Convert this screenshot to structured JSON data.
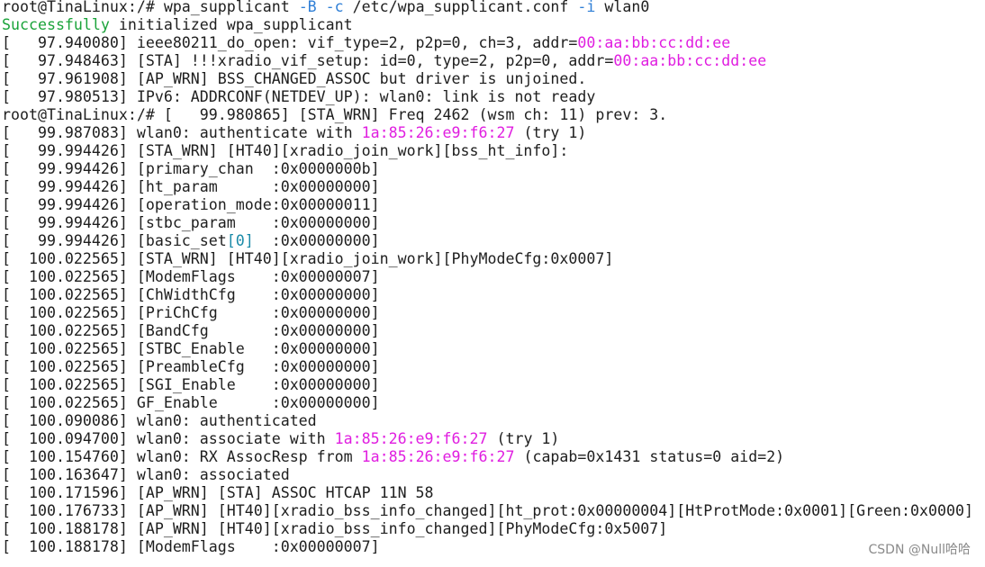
{
  "colors": {
    "background": "#ffffff",
    "text": "#1e1e1e",
    "green": "#1aa33a",
    "magenta": "#e01ee0",
    "blue": "#2f7fd6",
    "teal": "#1a8aa8"
  },
  "terminal": {
    "lines": [
      [
        {
          "t": "root@TinaLinux:/# wpa_supplicant "
        },
        {
          "t": "-B",
          "c": "blue"
        },
        {
          "t": " "
        },
        {
          "t": "-c",
          "c": "blue"
        },
        {
          "t": " /etc/wpa_supplicant.conf "
        },
        {
          "t": "-i",
          "c": "blue"
        },
        {
          "t": " wlan0"
        }
      ],
      [
        {
          "t": "Successfully",
          "c": "green"
        },
        {
          "t": " initialized wpa_supplicant"
        }
      ],
      [
        {
          "t": "[   97.940080] ieee80211_do_open: vif_type=2, p2p=0, ch=3, addr="
        },
        {
          "t": "00:aa:bb:cc:dd:ee",
          "c": "magenta"
        }
      ],
      [
        {
          "t": "[   97.948463] [STA] !!!xradio_vif_setup: id=0, type=2, p2p=0, addr="
        },
        {
          "t": "00:aa:bb:cc:dd:ee",
          "c": "magenta"
        }
      ],
      [
        {
          "t": "[   97.961908] [AP_WRN] BSS_CHANGED_ASSOC but driver is unjoined."
        }
      ],
      [
        {
          "t": "[   97.980513] IPv6: ADDRCONF(NETDEV_UP): wlan0: link is not ready"
        }
      ],
      [
        {
          "t": "root@TinaLinux:/# [   99.980865] [STA_WRN] Freq 2462 (wsm ch: 11) prev: 3."
        }
      ],
      [
        {
          "t": "[   99.987083] wlan0: authenticate with "
        },
        {
          "t": "1a:85:26:e9:f6:27",
          "c": "magenta"
        },
        {
          "t": " (try 1)"
        }
      ],
      [
        {
          "t": "[   99.994426] [STA_WRN] [HT40][xradio_join_work][bss_ht_info]:"
        }
      ],
      [
        {
          "t": "[   99.994426] [primary_chan  :0x0000000b]"
        }
      ],
      [
        {
          "t": "[   99.994426] [ht_param      :0x00000000]"
        }
      ],
      [
        {
          "t": "[   99.994426] [operation_mode:0x00000011]"
        }
      ],
      [
        {
          "t": "[   99.994426] [stbc_param    :0x00000000]"
        }
      ],
      [
        {
          "t": "[   99.994426] [basic_set"
        },
        {
          "t": "[0]",
          "c": "teal"
        },
        {
          "t": "  :0x00000000]"
        }
      ],
      [
        {
          "t": "[  100.022565] [STA_WRN] [HT40][xradio_join_work][PhyModeCfg:0x0007]"
        }
      ],
      [
        {
          "t": "[  100.022565] [ModemFlags    :0x00000007]"
        }
      ],
      [
        {
          "t": "[  100.022565] [ChWidthCfg    :0x00000000]"
        }
      ],
      [
        {
          "t": "[  100.022565] [PriChCfg      :0x00000000]"
        }
      ],
      [
        {
          "t": "[  100.022565] [BandCfg       :0x00000000]"
        }
      ],
      [
        {
          "t": "[  100.022565] [STBC_Enable   :0x00000000]"
        }
      ],
      [
        {
          "t": "[  100.022565] [PreambleCfg   :0x00000000]"
        }
      ],
      [
        {
          "t": "[  100.022565] [SGI_Enable    :0x00000000]"
        }
      ],
      [
        {
          "t": "[  100.022565] GF_Enable      :0x00000000]"
        }
      ],
      [
        {
          "t": "[  100.090086] wlan0: authenticated"
        }
      ],
      [
        {
          "t": "[  100.094700] wlan0: associate with "
        },
        {
          "t": "1a:85:26:e9:f6:27",
          "c": "magenta"
        },
        {
          "t": " (try 1)"
        }
      ],
      [
        {
          "t": "[  100.154760] wlan0: RX AssocResp from "
        },
        {
          "t": "1a:85:26:e9:f6:27",
          "c": "magenta"
        },
        {
          "t": " (capab=0x1431 status=0 aid=2)"
        }
      ],
      [
        {
          "t": "[  100.163647] wlan0: associated"
        }
      ],
      [
        {
          "t": "[  100.171596] [AP_WRN] [STA] ASSOC HTCAP 11N 58"
        }
      ],
      [
        {
          "t": "[  100.176733] [AP_WRN] [HT40][xradio_bss_info_changed][ht_prot:0x00000004][HtProtMode:0x0001][Green:0x0000]"
        }
      ],
      [
        {
          "t": "[  100.188178] [AP_WRN] [HT40][xradio_bss_info_changed][PhyModeCfg:0x5007]"
        }
      ],
      [
        {
          "t": "[  100.188178] [ModemFlags    :0x00000007]"
        }
      ]
    ]
  },
  "watermark": "CSDN @Null哈哈"
}
